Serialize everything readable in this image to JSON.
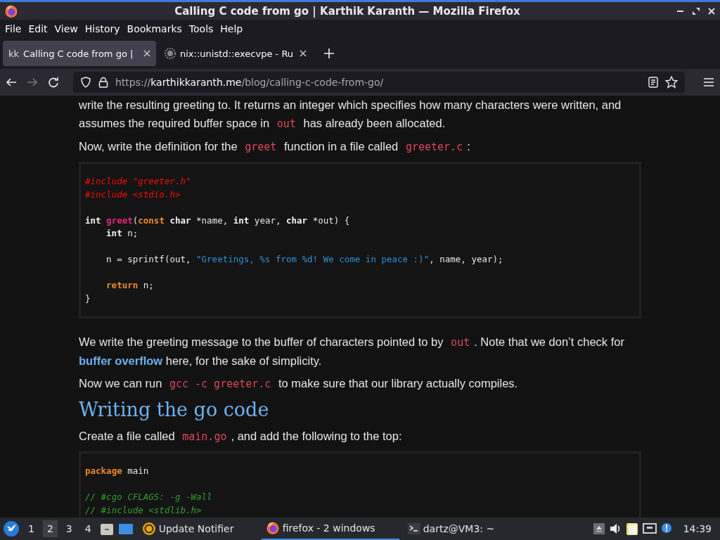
{
  "window": {
    "title": "Calling C code from go | Karthik Karanth — Mozilla Firefox"
  },
  "menu": [
    "File",
    "Edit",
    "View",
    "History",
    "Bookmarks",
    "Tools",
    "Help"
  ],
  "tabs": [
    {
      "favicon_text": "kk",
      "label": "Calling C code from go |",
      "selected": true
    },
    {
      "label": "nix::unistd::execvpe - Ru",
      "selected": false
    }
  ],
  "url": {
    "scheme": "https://",
    "host": "karthikkaranth.me",
    "path": "/blog/calling-c-code-from-go/"
  },
  "article": [
    {
      "kind": "para",
      "parts": [
        {
          "kind": "text",
          "text": "write the resulting greeting to. It returns an integer which specifies how many characters were written, and assumes the required buffer space in "
        },
        {
          "kind": "code",
          "text": "out"
        },
        {
          "kind": "text",
          "text": " has already been allocated."
        }
      ]
    },
    {
      "kind": "para",
      "parts": [
        {
          "kind": "text",
          "text": "Now, write the definition for the "
        },
        {
          "kind": "code",
          "text": "greet"
        },
        {
          "kind": "text",
          "text": " function in a file called "
        },
        {
          "kind": "code",
          "text": "greeter.c"
        },
        {
          "kind": "text",
          "text": ":"
        }
      ]
    },
    {
      "kind": "codeblock",
      "lines": [
        {
          "kind": "code",
          "indented": false,
          "tokens": [
            {
              "kind": "preproc",
              "text": "#include \"greeter.h\""
            }
          ]
        },
        {
          "kind": "code",
          "indented": false,
          "tokens": [
            {
              "kind": "preproc",
              "text": "#include <stdio.h>"
            }
          ]
        },
        {
          "kind": "blank"
        },
        {
          "kind": "code",
          "indented": false,
          "tokens": [
            {
              "kind": "type",
              "text": "int "
            },
            {
              "kind": "func",
              "text": "greet"
            },
            {
              "kind": "plain",
              "text": "("
            },
            {
              "kind": "keyword",
              "text": "const "
            },
            {
              "kind": "type",
              "text": "char"
            },
            {
              "kind": "plain",
              "text": " *name, "
            },
            {
              "kind": "type",
              "text": "int"
            },
            {
              "kind": "plain",
              "text": " year, "
            },
            {
              "kind": "type",
              "text": "char"
            },
            {
              "kind": "plain",
              "text": " *out) {"
            }
          ]
        },
        {
          "kind": "code",
          "indented": true,
          "tokens": [
            {
              "kind": "type",
              "text": "int"
            },
            {
              "kind": "plain",
              "text": " n;"
            }
          ]
        },
        {
          "kind": "blank"
        },
        {
          "kind": "code",
          "indented": true,
          "tokens": [
            {
              "kind": "plain",
              "text": "n = sprintf(out, "
            },
            {
              "kind": "string",
              "text": "\"Greetings, %s from %d! We come in peace :)\""
            },
            {
              "kind": "plain",
              "text": ", name, year);"
            }
          ]
        },
        {
          "kind": "blank"
        },
        {
          "kind": "code",
          "indented": true,
          "tokens": [
            {
              "kind": "keyword",
              "text": "return"
            },
            {
              "kind": "plain",
              "text": " n;"
            }
          ]
        },
        {
          "kind": "code",
          "indented": false,
          "tokens": [
            {
              "kind": "plain",
              "text": "}"
            }
          ]
        }
      ]
    },
    {
      "kind": "para",
      "parts": [
        {
          "kind": "text",
          "text": "We write the greeting message to the buffer of characters pointed to by "
        },
        {
          "kind": "code",
          "text": "out"
        },
        {
          "kind": "text",
          "text": ". Note that we don’t check for "
        },
        {
          "kind": "link",
          "text": "buffer overflow"
        },
        {
          "kind": "text",
          "text": " here, for the sake of simplicity."
        }
      ]
    },
    {
      "kind": "para",
      "parts": [
        {
          "kind": "text",
          "text": "Now we can run "
        },
        {
          "kind": "code",
          "text": "gcc -c greeter.c"
        },
        {
          "kind": "text",
          "text": " to make sure that our library actually compiles."
        }
      ]
    },
    {
      "kind": "heading",
      "text": "Writing the go code"
    },
    {
      "kind": "para",
      "parts": [
        {
          "kind": "text",
          "text": "Create a file called "
        },
        {
          "kind": "code",
          "text": "main.go"
        },
        {
          "kind": "text",
          "text": ", and add the following to the top:"
        }
      ]
    },
    {
      "kind": "codeblock",
      "lines": [
        {
          "kind": "code",
          "indented": false,
          "tokens": [
            {
              "kind": "keyword",
              "text": "package"
            },
            {
              "kind": "plain",
              "text": " main"
            }
          ]
        },
        {
          "kind": "blank"
        },
        {
          "kind": "code",
          "indented": false,
          "tokens": [
            {
              "kind": "comment",
              "text": "// #cgo CFLAGS: -g -Wall"
            }
          ]
        },
        {
          "kind": "code",
          "indented": false,
          "tokens": [
            {
              "kind": "comment",
              "text": "// #include <stdlib.h>"
            }
          ]
        }
      ]
    }
  ],
  "taskbar": {
    "workspaces": [
      {
        "label": "1",
        "selected": false
      },
      {
        "label": "2",
        "selected": true
      },
      {
        "label": "3",
        "selected": false
      },
      {
        "label": "4",
        "selected": false
      }
    ],
    "tasks": [
      {
        "kind": "notifier",
        "label": "Update Notifier",
        "selected": false
      },
      {
        "kind": "firefox",
        "label": "firefox - 2 windows",
        "selected": true
      },
      {
        "kind": "terminal",
        "label": "dartz@VM3: ~",
        "selected": false
      }
    ],
    "clock": "14:39"
  }
}
